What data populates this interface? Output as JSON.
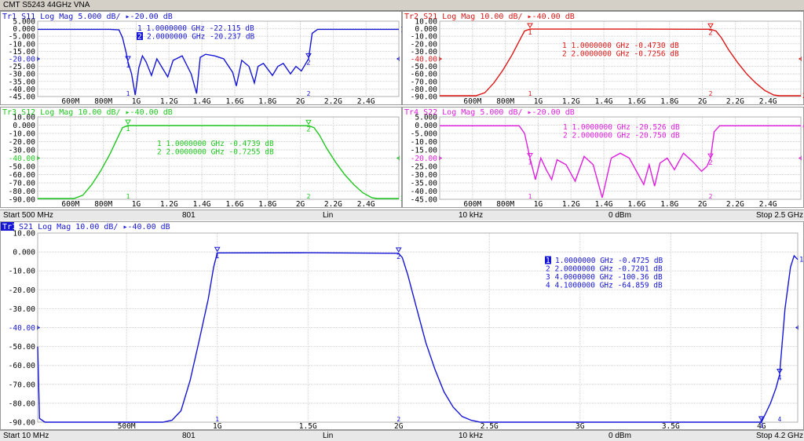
{
  "app": {
    "title": "CMT S5243 44GHz VNA"
  },
  "colors": {
    "tr1": "#1515d6",
    "tr2": "#e01515",
    "tr3": "#1ec81e",
    "tr4": "#e01ee0",
    "grid": "#c8c8c8"
  },
  "ch1_status": {
    "start": "Start 500 MHz",
    "points": "801",
    "sweep": "Lin",
    "ifbw": "10 kHz",
    "power": "0 dBm",
    "stop": "Stop 2.5 GHz"
  },
  "ch2_status": {
    "start": "Start 10 MHz",
    "points": "801",
    "sweep": "Lin",
    "ifbw": "10 kHz",
    "power": "0 dBm",
    "stop": "Stop 4.2 GHz"
  },
  "chart_data": [
    {
      "type": "line",
      "title": "Tr1 S11 Log Mag 5.000 dB/ ▸-20.00 dB",
      "trace": "Tr1",
      "color": "#1515d6",
      "xlim": [
        0.5,
        2.5
      ],
      "ylim": [
        -45,
        5
      ],
      "yticks": [
        "5.000",
        "0.000",
        "-5.000",
        "-10.00",
        "-15.00",
        "-20.00",
        "-25.00",
        "-30.00",
        "-35.00",
        "-40.00",
        "-45.00"
      ],
      "xticks": [
        "600M",
        "800M",
        "1G",
        "1.2G",
        "1.4G",
        "1.6G",
        "1.8G",
        "2G",
        "2.2G",
        "2.4G"
      ],
      "ref_level": -20,
      "markers": [
        {
          "id": "1",
          "text": "1  1.0000000 GHz  -22.115  dB",
          "x": 1.0,
          "y": -22.1,
          "active": false
        },
        {
          "id": "2",
          "text": "2  2.0000000 GHz  -20.237  dB",
          "x": 2.0,
          "y": -20.2,
          "active": true
        }
      ],
      "series": [
        {
          "x": [
            0.5,
            0.9,
            0.95,
            0.97,
            0.99,
            1.0,
            1.02,
            1.04,
            1.06,
            1.08,
            1.1,
            1.13,
            1.16,
            1.19,
            1.22,
            1.25,
            1.3,
            1.35,
            1.38,
            1.4,
            1.43,
            1.48,
            1.53,
            1.58,
            1.6,
            1.63,
            1.67,
            1.7,
            1.72,
            1.75,
            1.8,
            1.83,
            1.86,
            1.9,
            1.93,
            1.96,
            1.98,
            2.0,
            2.02,
            2.05,
            2.1,
            2.5
          ],
          "y": [
            -0.4,
            -0.4,
            -0.8,
            -6,
            -16,
            -22,
            -30,
            -44,
            -26,
            -18,
            -22,
            -31,
            -20,
            -26,
            -32,
            -21,
            -18,
            -30,
            -43,
            -19,
            -17,
            -18,
            -20,
            -29,
            -38,
            -21,
            -25,
            -36,
            -25,
            -23,
            -31,
            -25,
            -23,
            -30,
            -25,
            -28,
            -24,
            -20,
            -3,
            -0.4,
            -0.4,
            -0.4
          ]
        }
      ]
    },
    {
      "type": "line",
      "title": "Tr2 S21 Log Mag 10.00 dB/ ▸-40.00 dB",
      "trace": "Tr2",
      "color": "#e01515",
      "xlim": [
        0.5,
        2.5
      ],
      "ylim": [
        -90,
        10
      ],
      "yticks": [
        "10.00",
        "0.000",
        "-10.00",
        "-20.00",
        "-30.00",
        "-40.00",
        "-50.00",
        "-60.00",
        "-70.00",
        "-80.00",
        "-90.00"
      ],
      "xticks": [
        "600M",
        "800M",
        "1G",
        "1.2G",
        "1.4G",
        "1.6G",
        "1.8G",
        "2G",
        "2.2G",
        "2.4G"
      ],
      "ref_level": -40,
      "markers": [
        {
          "id": "1",
          "text": "1  1.0000000 GHz  -0.4730  dB",
          "x": 1.0,
          "y": -0.47,
          "active": false
        },
        {
          "id": "2",
          "text": "2  2.0000000 GHz  -0.7256  dB",
          "x": 2.0,
          "y": -0.73,
          "active": false
        }
      ],
      "series": [
        {
          "x": [
            0.5,
            0.7,
            0.75,
            0.8,
            0.85,
            0.9,
            0.95,
            0.97,
            1.0,
            1.5,
            2.0,
            2.03,
            2.06,
            2.1,
            2.15,
            2.2,
            2.25,
            2.3,
            2.35,
            2.38,
            2.5
          ],
          "y": [
            -89,
            -89,
            -85,
            -72,
            -55,
            -35,
            -12,
            -3,
            -0.5,
            -0.5,
            -0.7,
            -3,
            -12,
            -28,
            -45,
            -60,
            -72,
            -82,
            -88,
            -89,
            -89
          ]
        }
      ]
    },
    {
      "type": "line",
      "title": "Tr3 S12 Log Mag 10.00 dB/ ▸-40.00 dB",
      "trace": "Tr3",
      "color": "#1ec81e",
      "xlim": [
        0.5,
        2.5
      ],
      "ylim": [
        -90,
        10
      ],
      "yticks": [
        "10.00",
        "0.000",
        "-10.00",
        "-20.00",
        "-30.00",
        "-40.00",
        "-50.00",
        "-60.00",
        "-70.00",
        "-80.00",
        "-90.00"
      ],
      "xticks": [
        "600M",
        "800M",
        "1G",
        "1.2G",
        "1.4G",
        "1.6G",
        "1.8G",
        "2G",
        "2.2G",
        "2.4G"
      ],
      "ref_level": -40,
      "markers": [
        {
          "id": "1",
          "text": "1  1.0000000 GHz  -0.4739  dB",
          "x": 1.0,
          "y": -0.47,
          "active": false
        },
        {
          "id": "2",
          "text": "2  2.0000000 GHz  -0.7255  dB",
          "x": 2.0,
          "y": -0.73,
          "active": false
        }
      ],
      "series": [
        {
          "x": [
            0.5,
            0.7,
            0.75,
            0.8,
            0.85,
            0.9,
            0.95,
            0.97,
            1.0,
            1.5,
            2.0,
            2.03,
            2.06,
            2.1,
            2.15,
            2.2,
            2.25,
            2.3,
            2.35,
            2.38,
            2.5
          ],
          "y": [
            -89,
            -89,
            -85,
            -72,
            -55,
            -35,
            -12,
            -3,
            -0.5,
            -0.5,
            -0.7,
            -3,
            -12,
            -28,
            -45,
            -60,
            -72,
            -82,
            -88,
            -89,
            -89
          ]
        }
      ]
    },
    {
      "type": "line",
      "title": "Tr4 S22 Log Mag 5.000 dB/ ▸-20.00 dB",
      "trace": "Tr4",
      "color": "#e01ee0",
      "xlim": [
        0.5,
        2.5
      ],
      "ylim": [
        -45,
        5
      ],
      "yticks": [
        "5.000",
        "0.000",
        "-5.000",
        "-10.00",
        "-15.00",
        "-20.00",
        "-25.00",
        "-30.00",
        "-35.00",
        "-40.00",
        "-45.00"
      ],
      "xticks": [
        "600M",
        "800M",
        "1G",
        "1.2G",
        "1.4G",
        "1.6G",
        "1.8G",
        "2G",
        "2.2G",
        "2.4G"
      ],
      "ref_level": -20,
      "markers": [
        {
          "id": "1",
          "text": "1  1.0000000 GHz  -20.526  dB",
          "x": 1.0,
          "y": -20.5,
          "active": false
        },
        {
          "id": "2",
          "text": "2  2.0000000 GHz  -20.750  dB",
          "x": 2.0,
          "y": -20.8,
          "active": false
        }
      ],
      "series": [
        {
          "x": [
            0.5,
            0.94,
            0.97,
            0.99,
            1.0,
            1.03,
            1.06,
            1.09,
            1.12,
            1.15,
            1.2,
            1.25,
            1.3,
            1.35,
            1.4,
            1.45,
            1.5,
            1.55,
            1.6,
            1.63,
            1.66,
            1.69,
            1.72,
            1.76,
            1.8,
            1.85,
            1.9,
            1.95,
            1.98,
            2.0,
            2.02,
            2.05,
            2.1,
            2.5
          ],
          "y": [
            -0.4,
            -0.4,
            -5,
            -15,
            -20,
            -33,
            -20,
            -27,
            -33,
            -21,
            -24,
            -34,
            -19,
            -24,
            -44,
            -20,
            -17,
            -20,
            -30,
            -36,
            -24,
            -37,
            -23,
            -20,
            -27,
            -17,
            -22,
            -28,
            -25,
            -20,
            -4,
            -0.4,
            -0.4,
            -0.4
          ]
        }
      ]
    },
    {
      "type": "line",
      "title": "Tr1 S21 Log Mag 10.00 dB/ ▸-40.00 dB",
      "trace": "Tr1",
      "color": "#1515d6",
      "xlim": [
        0.01,
        4.2
      ],
      "ylim": [
        -90,
        10
      ],
      "yticks": [
        "10.00",
        "0.000",
        "-10.00",
        "-20.00",
        "-30.00",
        "-40.00",
        "-50.00",
        "-60.00",
        "-70.00",
        "-80.00",
        "-90.00"
      ],
      "xticks": [
        "500M",
        "1G",
        "1.5G",
        "2G",
        "2.5G",
        "3G",
        "3.5G",
        "4G"
      ],
      "xtick_values": [
        0.5,
        1.0,
        1.5,
        2.0,
        2.5,
        3.0,
        3.5,
        4.0
      ],
      "ref_level": -40,
      "markers": [
        {
          "id": "1",
          "text": "1  1.0000000 GHz  -0.4725  dB",
          "x": 1.0,
          "y": -0.47,
          "active": true
        },
        {
          "id": "2",
          "text": "2  2.0000000 GHz  -0.7201  dB",
          "x": 2.0,
          "y": -0.72,
          "active": false
        },
        {
          "id": "3",
          "text": "3  4.0000000 GHz  -100.36  dB",
          "x": 4.0,
          "y": -100.4,
          "active": false
        },
        {
          "id": "4",
          "text": "4  4.1000000 GHz  -64.859  dB",
          "x": 4.1,
          "y": -64.9,
          "active": false
        }
      ],
      "series": [
        {
          "x": [
            0.01,
            0.02,
            0.05,
            0.7,
            0.75,
            0.8,
            0.85,
            0.9,
            0.95,
            0.98,
            1.0,
            1.5,
            2.0,
            2.02,
            2.05,
            2.1,
            2.15,
            2.2,
            2.25,
            2.3,
            2.35,
            2.4,
            2.45,
            3.95,
            4.0,
            4.05,
            4.08,
            4.1,
            4.13,
            4.16,
            4.18,
            4.2
          ],
          "y": [
            -50,
            -88,
            -90,
            -90,
            -89,
            -84,
            -68,
            -47,
            -25,
            -8,
            -0.5,
            -0.4,
            -0.7,
            -3,
            -12,
            -30,
            -48,
            -62,
            -74,
            -82,
            -87,
            -89,
            -90,
            -90,
            -92,
            -80,
            -72,
            -64.9,
            -30,
            -8,
            -2,
            -4
          ]
        }
      ]
    }
  ]
}
